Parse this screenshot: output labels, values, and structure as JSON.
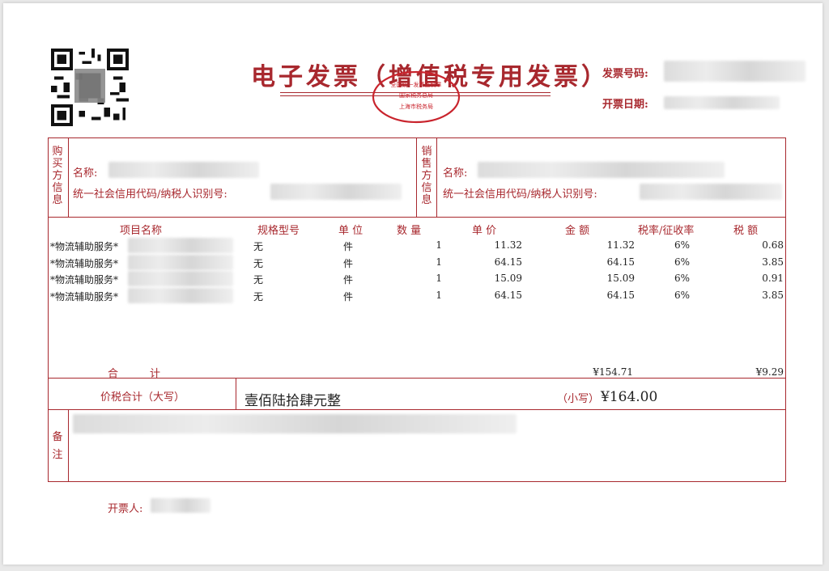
{
  "title": "电子发票（增值税专用发票）",
  "meta": {
    "invoice_no_label": "发票号码:",
    "issue_date_label": "开票日期:"
  },
  "seal": {
    "line1": "全国统一发票监制章",
    "line2": "国家税务总局",
    "line3": "上海市税务局"
  },
  "buyer": {
    "section_label": [
      "购",
      "买",
      "方",
      "信",
      "息"
    ],
    "name_label": "名称:",
    "taxid_label": "统一社会信用代码/纳税人识别号:"
  },
  "seller": {
    "section_label": [
      "销",
      "售",
      "方",
      "信",
      "息"
    ],
    "name_label": "名称:",
    "taxid_label": "统一社会信用代码/纳税人识别号:"
  },
  "columns": {
    "item": "项目名称",
    "spec": "规格型号",
    "unit": "单 位",
    "qty": "数 量",
    "price": "单 价",
    "amount": "金 额",
    "rate": "税率/征收率",
    "tax": "税 额"
  },
  "items": [
    {
      "name": "*物流辅助服务*",
      "spec": "无",
      "unit": "件",
      "qty": "1",
      "price": "11.32",
      "amount": "11.32",
      "rate": "6%",
      "tax": "0.68"
    },
    {
      "name": "*物流辅助服务*",
      "spec": "无",
      "unit": "件",
      "qty": "1",
      "price": "64.15",
      "amount": "64.15",
      "rate": "6%",
      "tax": "3.85"
    },
    {
      "name": "*物流辅助服务*",
      "spec": "无",
      "unit": "件",
      "qty": "1",
      "price": "15.09",
      "amount": "15.09",
      "rate": "6%",
      "tax": "0.91"
    },
    {
      "name": "*物流辅助服务*",
      "spec": "无",
      "unit": "件",
      "qty": "1",
      "price": "64.15",
      "amount": "64.15",
      "rate": "6%",
      "tax": "3.85"
    }
  ],
  "totals": {
    "label": "合　　　计",
    "amount": "¥154.71",
    "tax": "¥9.29"
  },
  "grand_total": {
    "label": "价税合计（大写）",
    "in_words": "壹佰陆拾肆元整",
    "small_label": "（小写）",
    "in_figures": "¥164.00"
  },
  "remarks": {
    "label": [
      "备",
      "注"
    ]
  },
  "issuer": {
    "label": "开票人:"
  }
}
